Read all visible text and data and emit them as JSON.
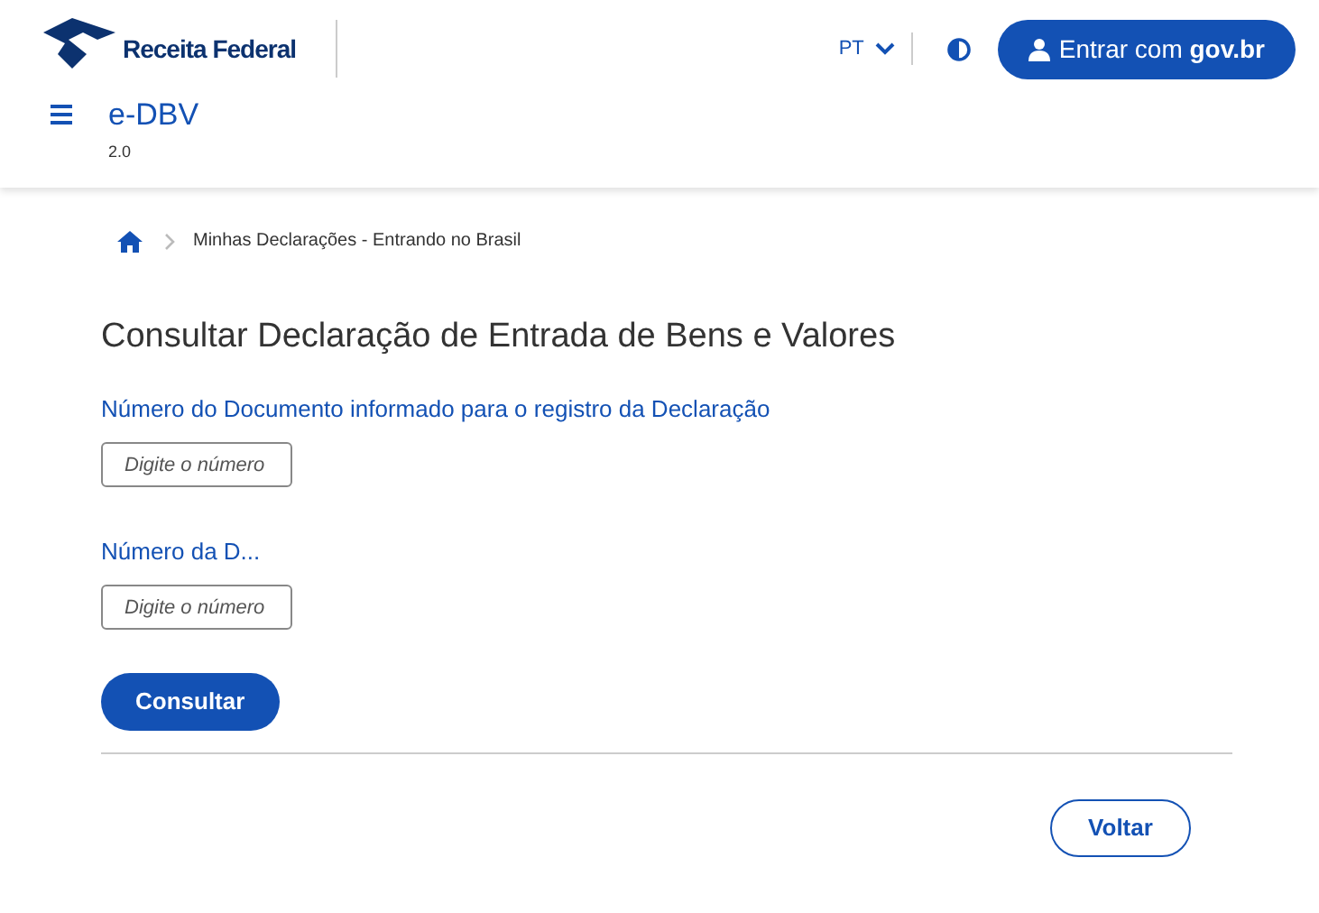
{
  "header": {
    "logo_text": "Receita Federal",
    "language": "PT",
    "login_button": "Entrar com **gov.br**",
    "app_title": "e-DBV",
    "app_version": "2.0"
  },
  "breadcrumb": {
    "items": [
      "Minhas Declarações - Entrando no Brasil"
    ]
  },
  "page_title": "Consultar Declaração de Entrada de Bens e Valores",
  "fields": [
    {
      "label": "Número do Documento informado para o registro da Declaração",
      "placeholder": "Digite o número"
    },
    {
      "label": "Número da D...",
      "placeholder": "Digite o número"
    }
  ],
  "submit_button": "Consultar",
  "back_button": "Voltar"
}
